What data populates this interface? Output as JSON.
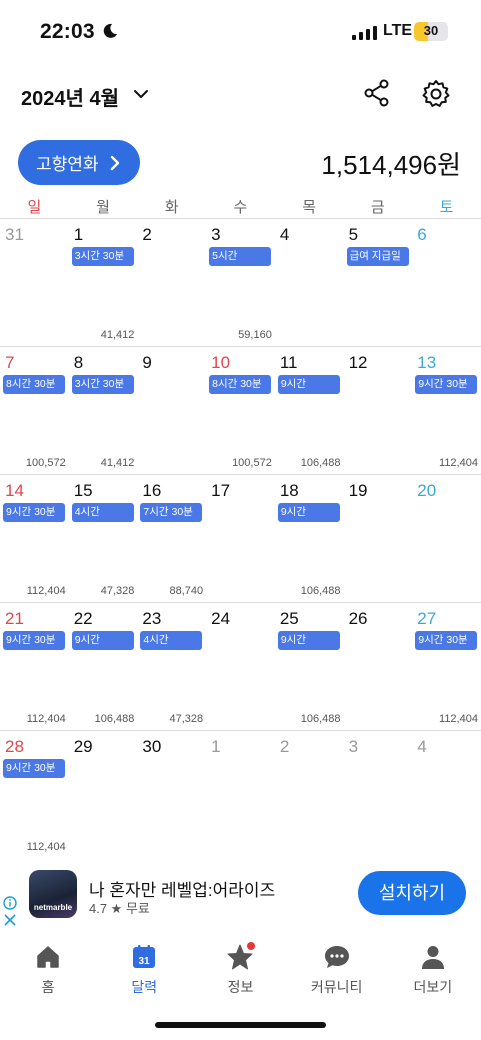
{
  "status_bar": {
    "time": "22:03",
    "network": "LTE",
    "battery": "30"
  },
  "header": {
    "month_title": "2024년 4월",
    "hometown_button": "고향연화",
    "total_amount": "1,514,496원"
  },
  "weekdays": [
    "일",
    "월",
    "화",
    "수",
    "목",
    "금",
    "토"
  ],
  "calendar": {
    "weeks": [
      {
        "days": [
          {
            "num": "31",
            "kind": "other",
            "shift": "",
            "earning": ""
          },
          {
            "num": "1",
            "kind": "weekday",
            "shift": "3시간 30분",
            "earning": "41,412"
          },
          {
            "num": "2",
            "kind": "weekday",
            "shift": "",
            "earning": ""
          },
          {
            "num": "3",
            "kind": "weekday",
            "shift": "5시간",
            "earning": "59,160"
          },
          {
            "num": "4",
            "kind": "weekday",
            "shift": "",
            "earning": ""
          },
          {
            "num": "5",
            "kind": "weekday",
            "shift": "급여 지급일",
            "earning": ""
          },
          {
            "num": "6",
            "kind": "sat",
            "shift": "",
            "earning": ""
          }
        ]
      },
      {
        "days": [
          {
            "num": "7",
            "kind": "sun",
            "shift": "8시간 30분",
            "earning": "100,572"
          },
          {
            "num": "8",
            "kind": "weekday",
            "shift": "3시간 30분",
            "earning": "41,412"
          },
          {
            "num": "9",
            "kind": "weekday",
            "shift": "",
            "earning": ""
          },
          {
            "num": "10",
            "kind": "sun",
            "shift": "8시간 30분",
            "earning": "100,572"
          },
          {
            "num": "11",
            "kind": "weekday",
            "shift": "9시간",
            "earning": "106,488"
          },
          {
            "num": "12",
            "kind": "weekday",
            "shift": "",
            "earning": ""
          },
          {
            "num": "13",
            "kind": "sat",
            "shift": "9시간 30분",
            "earning": "112,404"
          }
        ]
      },
      {
        "days": [
          {
            "num": "14",
            "kind": "sun",
            "shift": "9시간 30분",
            "earning": "112,404"
          },
          {
            "num": "15",
            "kind": "weekday",
            "shift": "4시간",
            "earning": "47,328"
          },
          {
            "num": "16",
            "kind": "weekday",
            "shift": "7시간 30분",
            "earning": "88,740"
          },
          {
            "num": "17",
            "kind": "weekday",
            "shift": "",
            "earning": ""
          },
          {
            "num": "18",
            "kind": "weekday",
            "shift": "9시간",
            "earning": "106,488"
          },
          {
            "num": "19",
            "kind": "weekday",
            "shift": "",
            "earning": ""
          },
          {
            "num": "20",
            "kind": "sat",
            "shift": "",
            "earning": ""
          }
        ]
      },
      {
        "days": [
          {
            "num": "21",
            "kind": "sun",
            "shift": "9시간 30분",
            "earning": "112,404"
          },
          {
            "num": "22",
            "kind": "weekday",
            "shift": "9시간",
            "earning": "106,488"
          },
          {
            "num": "23",
            "kind": "weekday",
            "shift": "4시간",
            "earning": "47,328"
          },
          {
            "num": "24",
            "kind": "weekday",
            "shift": "",
            "earning": ""
          },
          {
            "num": "25",
            "kind": "weekday",
            "shift": "9시간",
            "earning": "106,488"
          },
          {
            "num": "26",
            "kind": "weekday",
            "shift": "",
            "earning": ""
          },
          {
            "num": "27",
            "kind": "sat",
            "shift": "9시간 30분",
            "earning": "112,404"
          }
        ]
      },
      {
        "days": [
          {
            "num": "28",
            "kind": "sun",
            "shift": "9시간 30분",
            "earning": "112,404"
          },
          {
            "num": "29",
            "kind": "weekday",
            "shift": "",
            "earning": ""
          },
          {
            "num": "30",
            "kind": "weekday",
            "shift": "",
            "earning": ""
          },
          {
            "num": "1",
            "kind": "other",
            "shift": "",
            "earning": ""
          },
          {
            "num": "2",
            "kind": "other",
            "shift": "",
            "earning": ""
          },
          {
            "num": "3",
            "kind": "other",
            "shift": "",
            "earning": ""
          },
          {
            "num": "4",
            "kind": "other",
            "shift": "",
            "earning": ""
          }
        ]
      }
    ]
  },
  "ad": {
    "icon_text": "netmarble",
    "title": "나 혼자만 레벨업:어라이즈",
    "rating": "4.7 ★ 무료",
    "install_label": "설치하기"
  },
  "bottom_nav": {
    "items": [
      {
        "label": "홈",
        "icon": "home-icon",
        "active": false
      },
      {
        "label": "달력",
        "icon": "calendar-icon",
        "active": true,
        "badge_text": "31"
      },
      {
        "label": "정보",
        "icon": "star-icon",
        "active": false
      },
      {
        "label": "커뮤니티",
        "icon": "chat-icon",
        "active": false
      },
      {
        "label": "더보기",
        "icon": "person-icon",
        "active": false
      }
    ]
  },
  "colors": {
    "accent": "#2f6de1",
    "shift_bar": "#4a78e6",
    "sunday": "#e0474c",
    "saturday": "#3aa9d8"
  }
}
